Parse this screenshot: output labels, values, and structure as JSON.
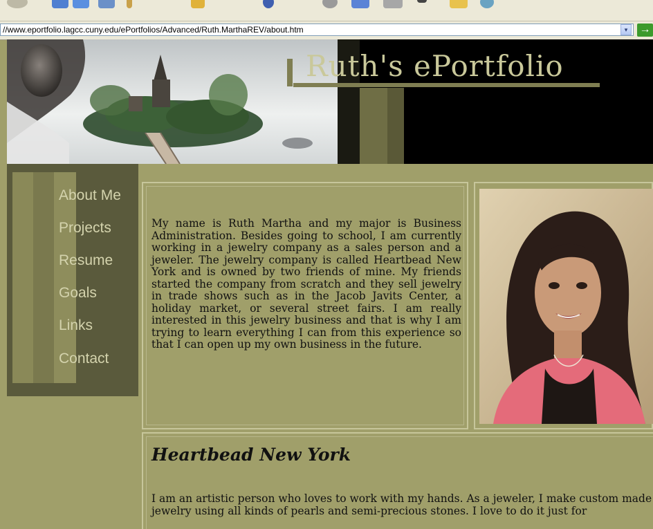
{
  "browser": {
    "url": "//www.eportfolio.lagcc.cuny.edu/ePortfolios/Advanced/Ruth.MarthaREV/about.htm",
    "dropdown_glyph": "▾",
    "go_glyph": "→"
  },
  "banner": {
    "title": "Ruth's ePortfolio"
  },
  "nav": [
    {
      "label": "About Me"
    },
    {
      "label": "Projects"
    },
    {
      "label": "Resume"
    },
    {
      "label": "Goals"
    },
    {
      "label": "Links"
    },
    {
      "label": "Contact"
    }
  ],
  "intro": {
    "text": "My name is Ruth Martha and my major is Business Administration. Besides going to school, I am currently working in a jewelry company as a sales person and a jeweler. The jewelry company is called Heartbead New York and is owned by two friends of mine. My friends started the company from scratch and they sell jewelry in trade shows such as in the Jacob Javits Center, a holiday market, or several street fairs. I am really interested in this jewelry business and that is why I am trying to learn everything I can from this experience so that I can open up my own business in the future."
  },
  "section": {
    "heading": "Heartbead New York",
    "text": "I am an artistic person who loves to work with my hands. As a jeweler, I make custom made jewelry using all kinds of pearls and semi-precious stones. I love to do it just for"
  },
  "colors": {
    "page_bg": "#a09f6a",
    "nav_text": "#d4d3ad",
    "title_text": "#c9c89a",
    "sidebar_bg": "#5a5a3c"
  }
}
